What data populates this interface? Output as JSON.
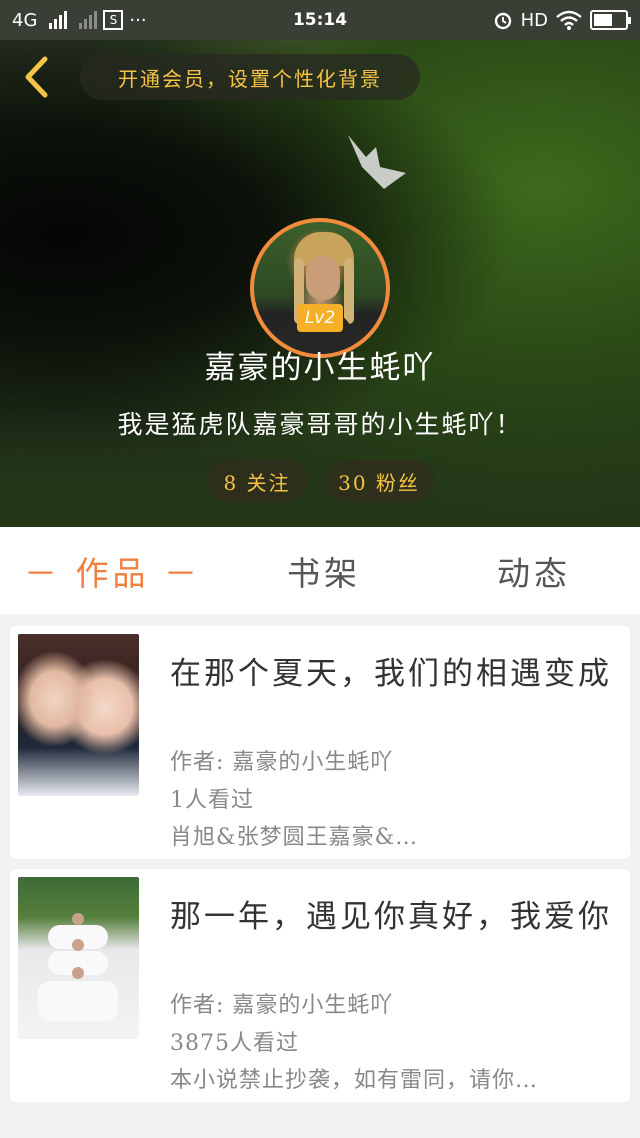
{
  "status_bar": {
    "network": "4G",
    "sim_label": "S",
    "more": "···",
    "time": "15:14",
    "hd": "HD"
  },
  "header": {
    "vip_banner": "开通会员，设置个性化背景",
    "level_badge": "Lv2",
    "nickname": "嘉豪的小生蚝吖",
    "bio": "我是猛虎队嘉豪哥哥的小生蚝吖！",
    "following": "8 关注",
    "followers": "30 粉丝"
  },
  "tabs": {
    "works": "－ 作品 －",
    "shelf": "书架",
    "moments": "动态"
  },
  "works": [
    {
      "title": "在那个夏天，我们的相遇变成",
      "author": "作者: 嘉豪的小生蚝吖",
      "views": "1人看过",
      "desc": "肖旭&张梦圆王嘉豪&…"
    },
    {
      "title": "那一年，遇见你真好，我爱你",
      "author": "作者: 嘉豪的小生蚝吖",
      "views": "3875人看过",
      "desc": "本小说禁止抄袭，如有雷同，请你…"
    }
  ],
  "colors": {
    "accent": "#f08040",
    "gold": "#f5c445",
    "level": "#f5b028",
    "avatar_ring": "#f28c3c"
  },
  "icons": {
    "back": "chevron-left-icon",
    "crown": "crown-icon",
    "alarm": "alarm-icon",
    "wifi": "wifi-icon",
    "battery": "battery-charging-icon"
  }
}
